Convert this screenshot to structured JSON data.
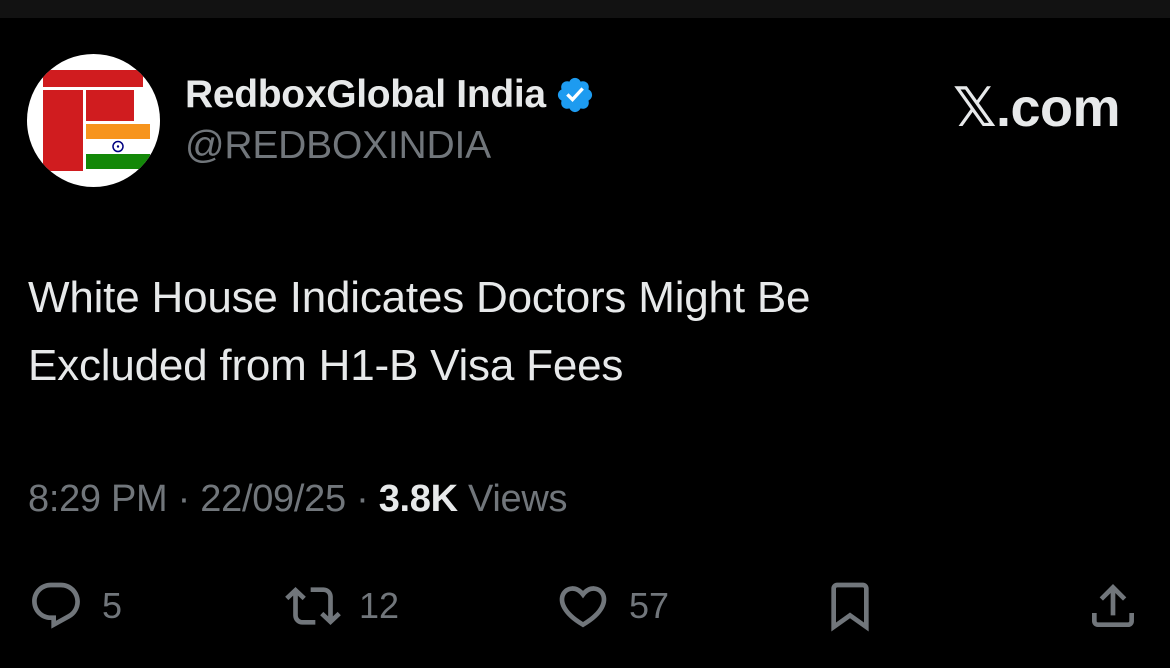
{
  "account": {
    "display_name": "RedboxGlobal India",
    "handle": "@REDBOXINDIA",
    "verified": true,
    "verified_color": "#1d9bf0",
    "avatar_icon": "redbox-india-flag-logo"
  },
  "brand": {
    "label": "𝕏.com"
  },
  "tweet": {
    "text_line1": "White House Indicates Doctors Might Be",
    "text_line2": "Excluded from H1-B Visa Fees"
  },
  "meta": {
    "time": "8:29 PM",
    "sep1": " · ",
    "date": "22/09/25",
    "sep2": " · ",
    "views_count": "3.8K",
    "views_label": " Views"
  },
  "actions": {
    "replies": {
      "icon": "reply-icon",
      "count": "5"
    },
    "reposts": {
      "icon": "repost-icon",
      "count": "12"
    },
    "likes": {
      "icon": "like-icon",
      "count": "57"
    },
    "bookmark": {
      "icon": "bookmark-icon"
    },
    "share": {
      "icon": "share-icon"
    }
  },
  "colors": {
    "background": "#000000",
    "primary_text": "#e7e9ea",
    "secondary_text": "#71767b",
    "logo_red": "#d01c1f",
    "saffron": "#f7941d",
    "india_green": "#138808",
    "chakra_blue": "#000080"
  }
}
